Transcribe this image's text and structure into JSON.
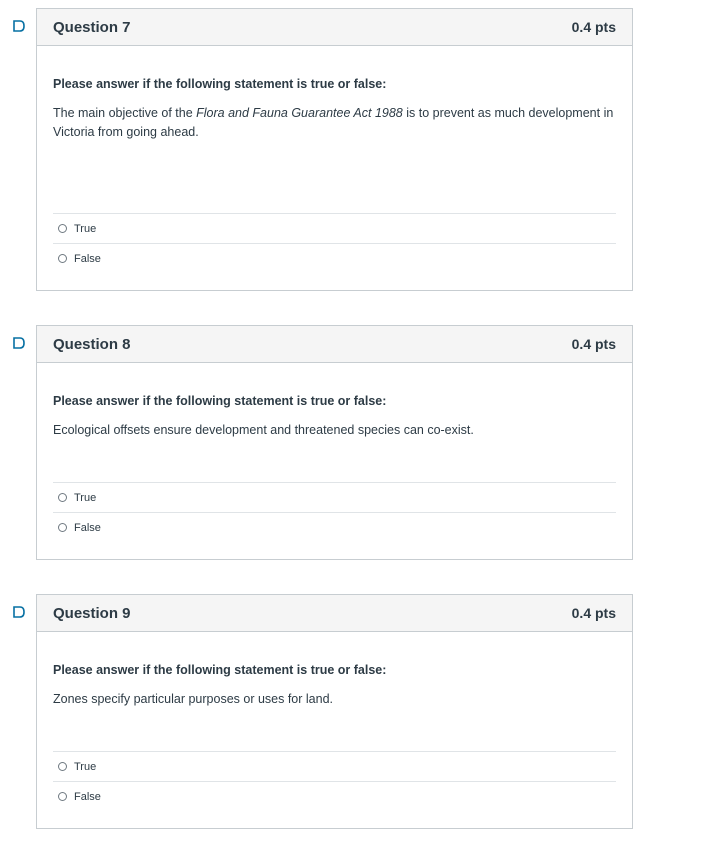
{
  "questions": [
    {
      "title": "Question 7",
      "points": "0.4 pts",
      "prompt": "Please answer if the following statement is true or false:",
      "statement_before": "The main objective of the ",
      "statement_italic": "Flora and Fauna Guarantee Act 1988",
      "statement_after": " is to prevent as much development in Victoria from going ahead.",
      "answers": [
        "True",
        "False"
      ]
    },
    {
      "title": "Question 8",
      "points": "0.4 pts",
      "prompt": "Please answer if the following statement is true or false:",
      "statement": "Ecological offsets ensure development and threatened species can co-exist.",
      "answers": [
        "True",
        "False"
      ]
    },
    {
      "title": "Question 9",
      "points": "0.4 pts",
      "prompt": "Please answer if the following statement is true or false:",
      "statement": "Zones specify particular purposes or uses for land.",
      "answers": [
        "True",
        "False"
      ]
    }
  ],
  "colors": {
    "header_bg": "#f5f5f5",
    "border": "#c7cdd1",
    "flag": "#0770a3",
    "text": "#2d3b45"
  },
  "icons": {
    "flag": "bookmark-flag-icon",
    "radio": "radio-unchecked-icon"
  }
}
